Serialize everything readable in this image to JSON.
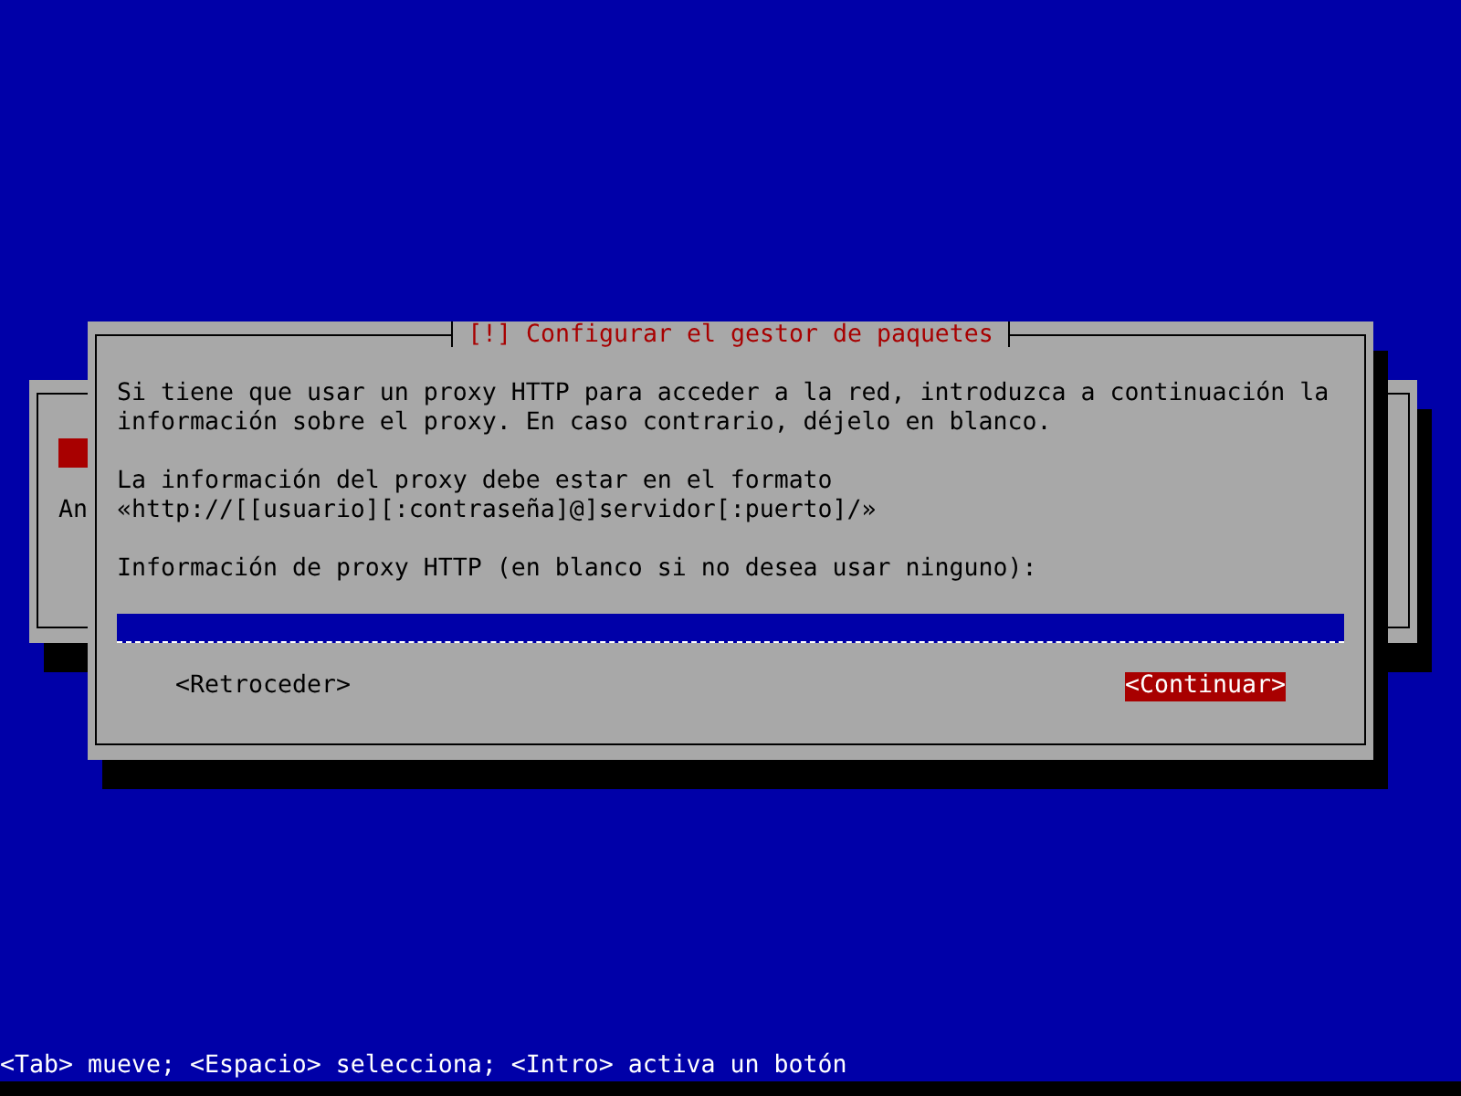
{
  "background_dialog": {
    "partial_text": "An",
    "marker": true
  },
  "dialog": {
    "title": "[!] Configurar el gestor de paquetes",
    "paragraphs": [
      [
        "Si tiene que usar un proxy HTTP para acceder a la red, introduzca a continuación la",
        "información sobre el proxy. En caso contrario, déjelo en blanco."
      ],
      [
        "La información del proxy debe estar en el formato",
        "«http://[[usuario][:contraseña]@]servidor[:puerto]/»"
      ],
      [
        "Información de proxy HTTP (en blanco si no desea usar ninguno):"
      ]
    ],
    "field": {
      "focused": true
    },
    "buttons": [
      {
        "label": "<Retroceder>",
        "selected": false
      },
      {
        "label": "<Continuar>",
        "selected": true
      }
    ]
  },
  "status_bar": "<Tab> mueve; <Espacio> selecciona; <Intro> activa un botón"
}
